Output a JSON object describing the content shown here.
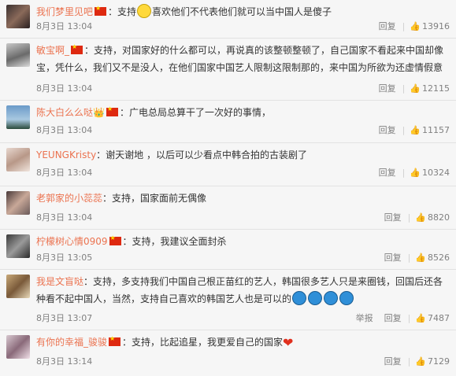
{
  "comments": [
    {
      "user": "我们梦里见吧",
      "text": "：支持",
      "emoji_after_text": "smile",
      "text2": "喜欢他们不代表他们就可以当中国人是傻子",
      "time": "8月3日 13:04",
      "reply": "回复",
      "likes": "13916",
      "report": ""
    },
    {
      "user": "敏宝啊_",
      "text": "：支持，对国家好的什么都可以，再说真的该整顿整顿了，自己国家不看起来中国却像宝，凭什么，我们又不是没人，在他们国家中国艺人限制这限制那的，来中国为所欲为还虚情假意",
      "time": "8月3日 13:04",
      "reply": "回复",
      "likes": "12115",
      "report": ""
    },
    {
      "user": "陈大白么么哒",
      "text": "：广电总局总算干了一次好的事情，",
      "time": "8月3日 13:04",
      "reply": "回复",
      "likes": "11157",
      "report": ""
    },
    {
      "user": "YEUNGKristy",
      "text": "：谢天谢地 ，以后可以少看点中韩合拍的古装剧了",
      "time": "8月3日 13:04",
      "reply": "回复",
      "likes": "10324",
      "report": ""
    },
    {
      "user": "老郭家的小蕊蕊",
      "text": "：支持，国家面前无偶像",
      "time": "8月3日 13:04",
      "reply": "回复",
      "likes": "8820",
      "report": ""
    },
    {
      "user": "柠檬树心情0909",
      "text": "：支持，我建议全面封杀",
      "time": "8月3日 13:05",
      "reply": "回复",
      "likes": "8526",
      "report": ""
    },
    {
      "user": "我是文盲哒",
      "text": "：支持，多支持我们中国自己根正苗红的艺人，韩国很多艺人只是来圈钱，回国后还各种看不起中国人，当然，支持自己喜欢的韩国艺人也是可以的",
      "time": "8月3日 13:07",
      "reply": "回复",
      "likes": "7487",
      "report": "举报"
    },
    {
      "user": "有你的幸福_骏骏",
      "text": "：支持，比起追星，我更爱自己的国家",
      "time": "8月3日 13:14",
      "reply": "回复",
      "likes": "7129",
      "report": ""
    }
  ],
  "colors": {
    "username": "#eb7350",
    "meta": "#808080",
    "background": "#f6f6f6"
  }
}
